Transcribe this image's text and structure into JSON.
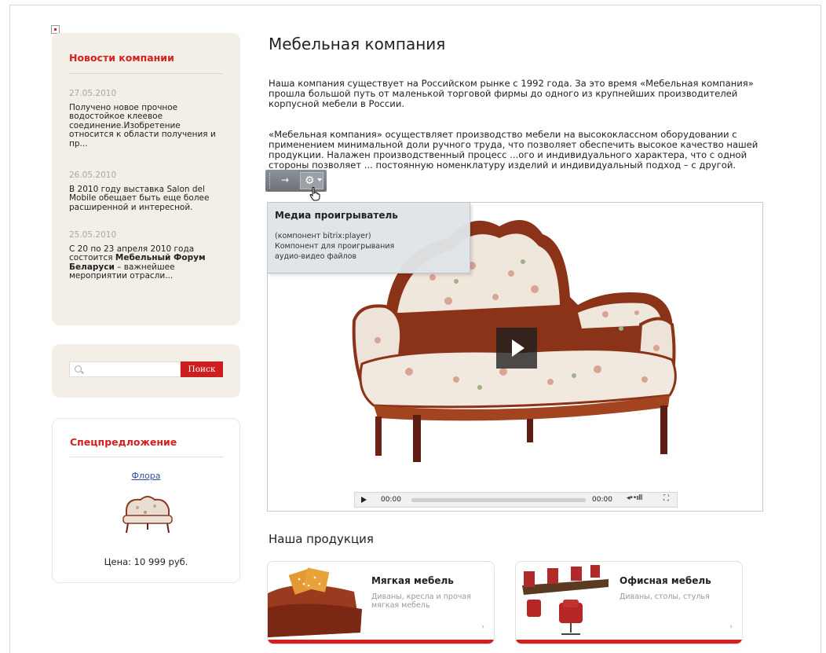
{
  "news": {
    "title": "Новости компании",
    "items": [
      {
        "date": "27.05.2010",
        "text": "Получено новое прочное водостойкое клеевое соединение.Изобретение относится к области получения и пр..."
      },
      {
        "date": "26.05.2010",
        "text": "В 2010 году выставка Salon del Mobile обещает быть еще более расширенной и интересной."
      },
      {
        "date": "25.05.2010",
        "text_before": "С 20 по 23 апреля 2010 года состоится ",
        "text_bold": "Мебельный Форум Беларуси",
        "text_after": " – важнейшее мероприятии отрасли..."
      }
    ]
  },
  "search": {
    "placeholder": "",
    "button_label": "Поиск"
  },
  "special": {
    "title": "Спецпредложение",
    "link": "Флора",
    "price": "Цена: 10 999 руб."
  },
  "main": {
    "title": "Мебельная компания",
    "paragraphs": [
      "Наша компания существует на Российском рынке с 1992 года. За это время «Мебельная компания» прошла большой путь от маленькой торговой фирмы до одного из крупнейших производителей корпусной мебели в России.",
      "«Мебельная компания» осуществляет производство мебели на высококлассном оборудовании с применением минимальной доли ручного труда, что позволяет обеспечить высокое качество нашей продукции. Налажен производственный процесс ...ого и индивидуального характера, что с одной стороны позволяет ... постоянную номенклатуру изделий и индивидуальный подход – с другой."
    ]
  },
  "player": {
    "time_current": "00:00",
    "time_total": "00:00",
    "volume_glyph": "◂••ıılll",
    "fullscreen_glyph": "⛶",
    "progress": 0
  },
  "edit_toolbar": {
    "arrow_glyph": "→",
    "gear_glyph": "⚙"
  },
  "tooltip": {
    "title": "Медиа проигрыватель",
    "lines": [
      "(компонент bitrix:player)",
      "Компонент для проигрывания",
      "аудио-видео файлов"
    ]
  },
  "products": {
    "title": "Наша продукция",
    "items": [
      {
        "title": "Мягкая мебель",
        "desc": "Диваны, кресла и прочая мягкая мебель",
        "arrow": "›"
      },
      {
        "title": "Офисная мебель",
        "desc": "Диваны, столы, стулья",
        "arrow": "›"
      }
    ]
  },
  "colors": {
    "accent": "#d42020",
    "box_bg": "#f3efe6",
    "link": "#2a4fa0"
  }
}
